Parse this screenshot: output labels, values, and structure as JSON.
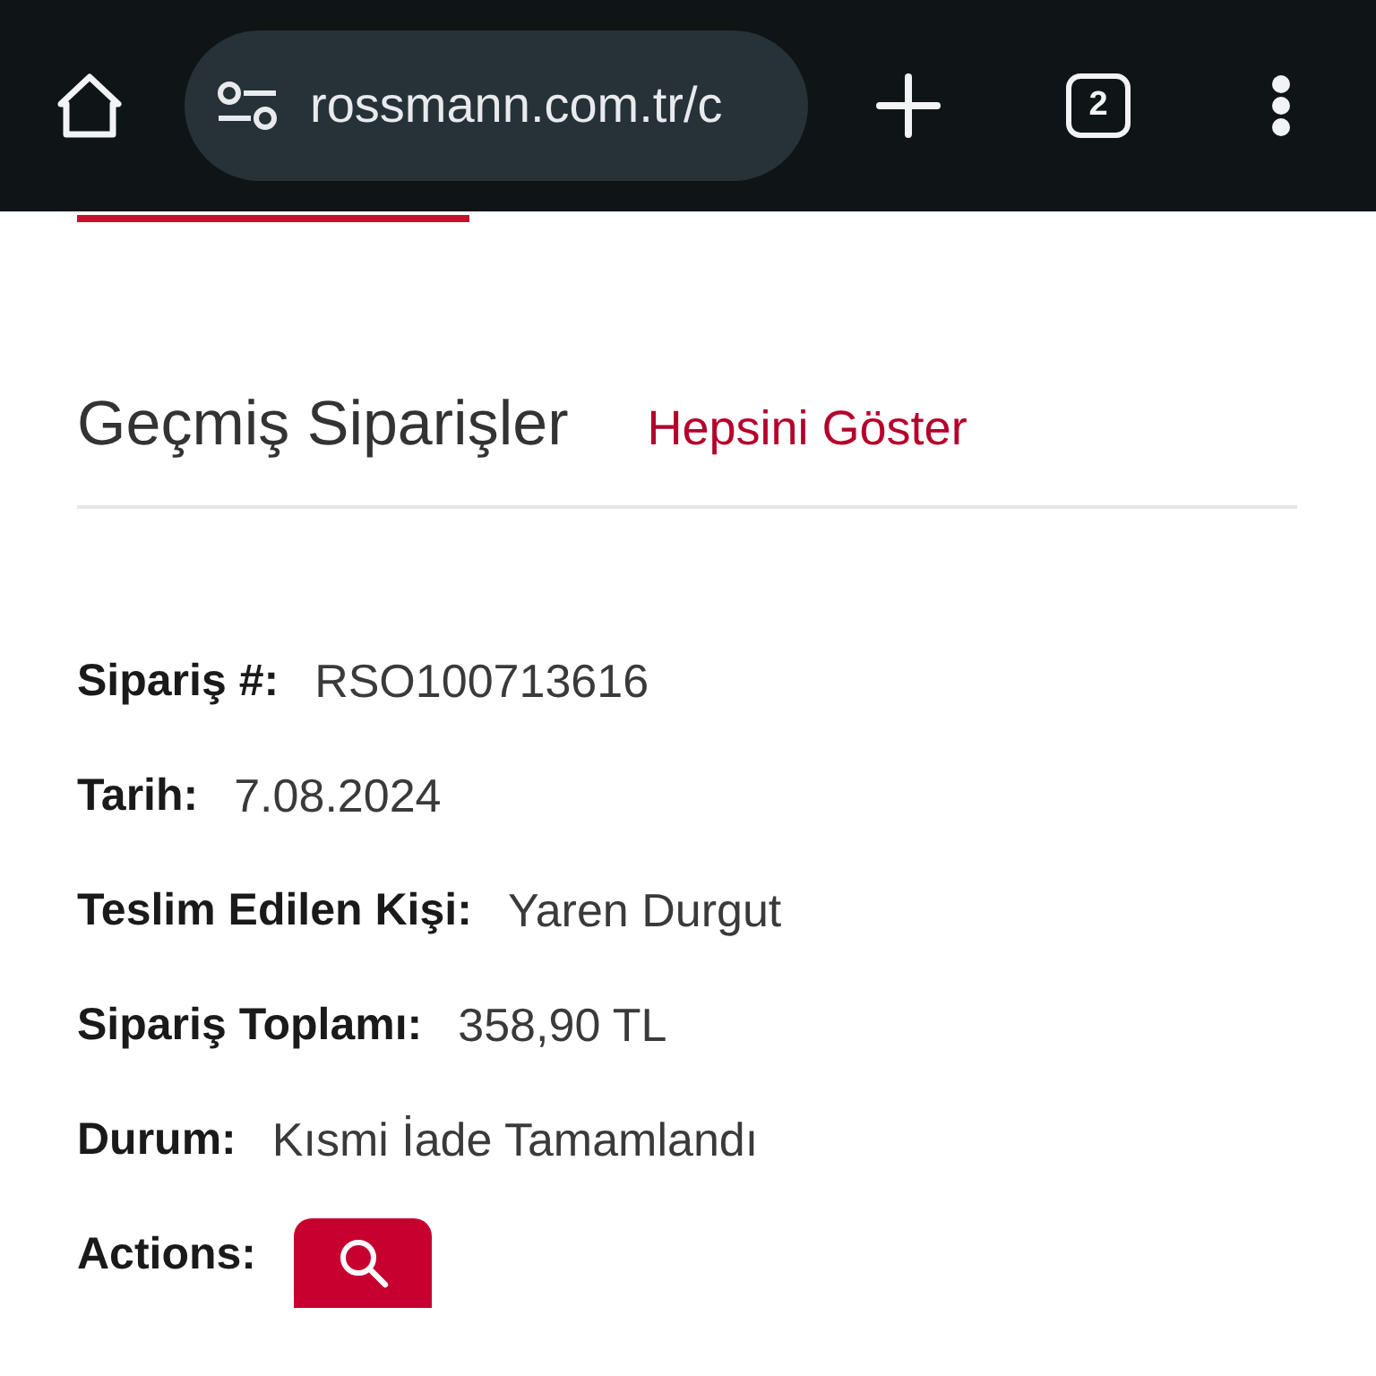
{
  "browser": {
    "url": "rossmann.com.tr/c",
    "tab_count": "2"
  },
  "section": {
    "title": "Geçmiş Siparişler",
    "link": "Hepsini Göster"
  },
  "order": {
    "fields": [
      {
        "label": "Sipariş #:",
        "value": "RSO100713616"
      },
      {
        "label": "Tarih:",
        "value": "7.08.2024"
      },
      {
        "label": "Teslim Edilen Kişi:",
        "value": "Yaren Durgut"
      },
      {
        "label": "Sipariş Toplamı:",
        "value": "358,90 TL"
      },
      {
        "label": "Durum:",
        "value": "Kısmi İade Tamamlandı"
      }
    ],
    "actions_label": "Actions:"
  }
}
